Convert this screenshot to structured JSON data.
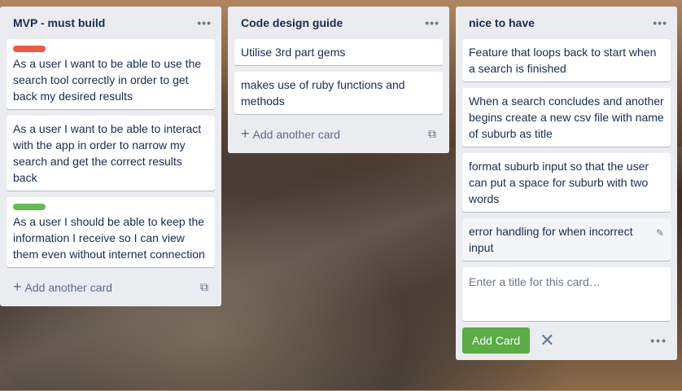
{
  "lists": [
    {
      "title": "MVP - must build",
      "cards": [
        {
          "text": "As a user I want to be able to use the search tool correctly in order to get back my desired results",
          "label": "#eb5a46"
        },
        {
          "text": "As a user I want to be able to interact with the app in order to narrow my search and get the correct results back"
        },
        {
          "text": "As a user I should be able to keep the information I receive so I can view them even without internet connection",
          "label": "#61bd4f"
        }
      ],
      "add_label": "Add another card"
    },
    {
      "title": "Code design guide",
      "cards": [
        {
          "text": "Utilise 3rd part gems"
        },
        {
          "text": "makes use of ruby functions and methods"
        }
      ],
      "add_label": "Add another card"
    },
    {
      "title": "nice to have",
      "cards": [
        {
          "text": "Feature that loops back to start when a search is finished"
        },
        {
          "text": "When a search concludes and another begins create a new csv file with name of suburb as title"
        },
        {
          "text": "format suburb input so that the user can put a space for suburb with two words"
        },
        {
          "text": "error handling for when incorrect input"
        }
      ],
      "composer_placeholder": "Enter a title for this card…",
      "add_card_button": "Add Card"
    }
  ],
  "menu_icon": "•••"
}
